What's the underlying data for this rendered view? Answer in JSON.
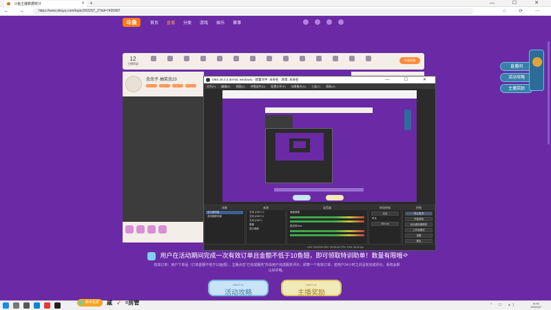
{
  "browser": {
    "tab_title": "斗鱼主播数据统计",
    "url": "https://www.douyu.com/topic/2022ST_2?rid=7420997",
    "new_tab": "+",
    "window_controls": "— ☐ ✕",
    "nav": "← → ⟳",
    "tray_icons": "☆ ⟳ ⋯"
  },
  "site": {
    "logo": "斗鱼",
    "nav": [
      "首页",
      "直播",
      "分类",
      "游戏",
      "娱乐",
      "赛事"
    ],
    "active_nav_index": 1
  },
  "stats": {
    "level_number": "12",
    "level_label": "主播等级",
    "cta_label": "申请开播"
  },
  "streamer": {
    "name": "念念子·抽奖念23"
  },
  "side_buttons": [
    "直播间",
    "活动攻略",
    "主播奖励"
  ],
  "obs": {
    "title": "OBS 26.0.2 (64-bit, windows) - 配置文件: 未命名 - 场景: 未命名",
    "menu": [
      "文件(F)",
      "编辑(E)",
      "视图(V)",
      "停靠部件(D)",
      "配置文件(P)",
      "场景集合(S)",
      "工具(T)",
      "帮助(H)"
    ],
    "docks": {
      "scenes_header": "场景",
      "scenes": [
        "显示器采集",
        "游戏捕获场景"
      ],
      "sources_header": "来源",
      "sources": [
        "文本 (GDI+) 3",
        "文本 (GDI+) 2",
        "文本 (GDI+)",
        "图像",
        "显示捕获"
      ],
      "mixer_header": "混音器",
      "mixer": [
        "桌面音频",
        "麦克风/Aux"
      ],
      "transitions_header": "转场特效",
      "transition_type": "淡出",
      "duration_label": "时长",
      "duration_value": "300 ms",
      "controls_header": "控制",
      "controls": [
        "停止推流",
        "开始录制",
        "启动虚拟摄像机",
        "工作室模式",
        "设置",
        "退出"
      ]
    },
    "status": "LIVE: 00:00:00   REC: 00:00:00   CPU: 3.5%, 30.00 fps"
  },
  "event": {
    "headline": "用户在活动期间完成一次有效订单且金额不低于10鱼翅，即可领取特训助单！数量有限哦~",
    "subtext": "有效订单：用户下单后（订单金额不低于10鱼翅），主播点击\"已完成服务\"并由用户完成服务评价，即算一个有效订单，若用户24小时之内没有完成评价，系统会默认好评哦。",
    "button_a_small": "PART 01",
    "button_a_label": "活动攻略",
    "button_b_small": "PART 02",
    "button_b_label": "主播奖励"
  },
  "overlay": {
    "pill": "新手任务",
    "text1": "戚",
    "text2": "=房管"
  },
  "taskbar": {
    "time": "14:51",
    "date": "2022/3/7",
    "tray": "^ ☐ ◂)"
  },
  "colors": {
    "page_bg": "#6a2aa5",
    "accent": "#ff7a1a",
    "obs_bg": "#2b2b2b"
  }
}
